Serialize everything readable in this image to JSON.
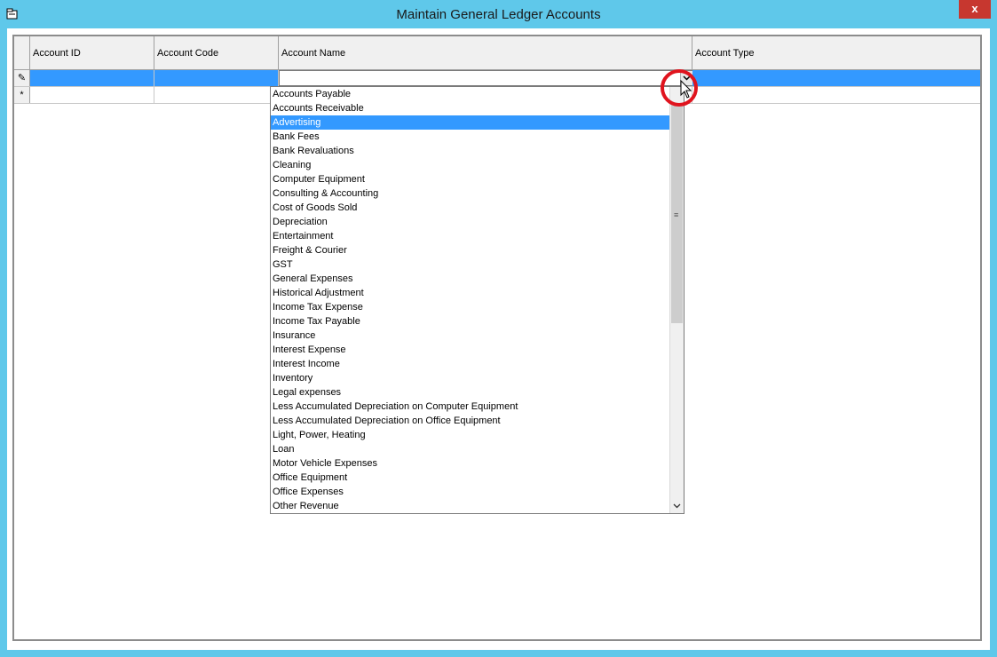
{
  "window": {
    "title": "Maintain General Ledger Accounts",
    "close_label": "x"
  },
  "grid": {
    "columns": [
      "Account ID",
      "Account Code",
      "Account Name",
      "Account Type"
    ],
    "row_markers": {
      "edit": "✎",
      "new": "*"
    }
  },
  "dropdown": {
    "selected_value": "Advertising",
    "items": [
      "Accounts Payable",
      "Accounts Receivable",
      "Advertising",
      "Bank Fees",
      "Bank Revaluations",
      "Cleaning",
      "Computer Equipment",
      "Consulting & Accounting",
      "Cost of Goods Sold",
      "Depreciation",
      "Entertainment",
      "Freight & Courier",
      "GST",
      "General Expenses",
      "Historical Adjustment",
      "Income Tax Expense",
      "Income Tax Payable",
      "Insurance",
      "Interest Expense",
      "Interest Income",
      "Inventory",
      "Legal expenses",
      "Less Accumulated Depreciation on Computer Equipment",
      "Less Accumulated Depreciation on Office Equipment",
      "Light, Power, Heating",
      "Loan",
      "Motor Vehicle Expenses",
      "Office Equipment",
      "Office Expenses",
      "Other Revenue"
    ]
  },
  "icons": {
    "window_icon": "folder-icon",
    "dropdown_arrow": "chevron-down-icon",
    "scroll_down": "chevron-down-icon",
    "scroll_grip": "grip-icon",
    "cursor": "mouse-pointer-icon"
  },
  "colors": {
    "titlebar": "#5fc8ea",
    "selection": "#3399ff",
    "close_button": "#c7372f",
    "highlight_circle": "#e0141e"
  }
}
